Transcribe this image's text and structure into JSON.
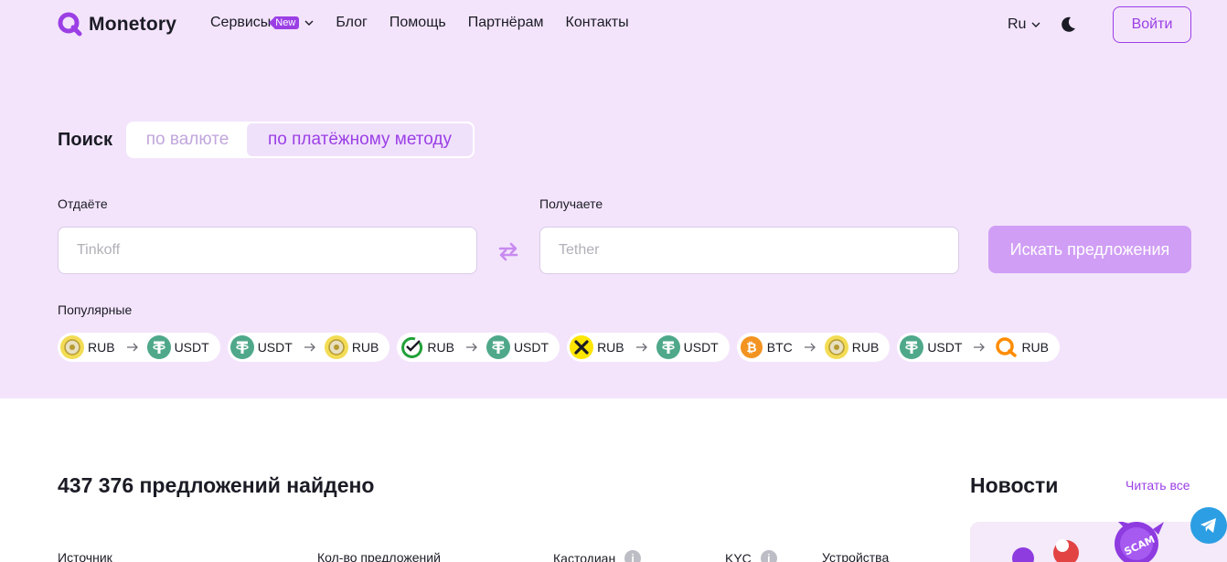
{
  "header": {
    "logo_text": "Monetory",
    "nav": [
      {
        "label": "Сервисы",
        "badge": "New"
      },
      {
        "label": "Блог"
      },
      {
        "label": "Помощь"
      },
      {
        "label": "Партнёрам"
      },
      {
        "label": "Контакты"
      }
    ],
    "language": "Ru",
    "login_label": "Войти"
  },
  "search": {
    "title": "Поиск",
    "tabs": [
      {
        "label": "по валюте",
        "active": false
      },
      {
        "label": "по платёжному методу",
        "active": true
      }
    ],
    "give_label": "Отдаёте",
    "give_placeholder": "Tinkoff",
    "get_label": "Получаете",
    "get_placeholder": "Tether",
    "submit_label": "Искать предложения"
  },
  "popular": {
    "label": "Популярные",
    "pairs": [
      {
        "from": "RUB",
        "from_icon": "tinkoff-icon",
        "to": "USDT",
        "to_icon": "tether-icon"
      },
      {
        "from": "USDT",
        "from_icon": "tether-icon",
        "to": "RUB",
        "to_icon": "tinkoff-icon"
      },
      {
        "from": "RUB",
        "from_icon": "sberbank-icon",
        "to": "USDT",
        "to_icon": "tether-icon"
      },
      {
        "from": "RUB",
        "from_icon": "raiffeisen-icon",
        "to": "USDT",
        "to_icon": "tether-icon"
      },
      {
        "from": "BTC",
        "from_icon": "bitcoin-icon",
        "to": "RUB",
        "to_icon": "tinkoff-icon"
      },
      {
        "from": "USDT",
        "from_icon": "tether-icon",
        "to": "RUB",
        "to_icon": "qiwi-icon"
      }
    ]
  },
  "results": {
    "title": "437 376 предложений найдено",
    "columns": [
      "Источник",
      "Кол-во предложений",
      "Кастодиан",
      "KYC",
      "Устройства"
    ]
  },
  "news": {
    "title": "Новости",
    "read_all": "Читать все"
  },
  "colors": {
    "accent": "#9b3fe5",
    "hero_bg": "#f3e4fb",
    "button_disabled": "#d09ef5",
    "tether": "#4fa88a",
    "bitcoin": "#f39321",
    "telegram": "#2c9ee3"
  }
}
